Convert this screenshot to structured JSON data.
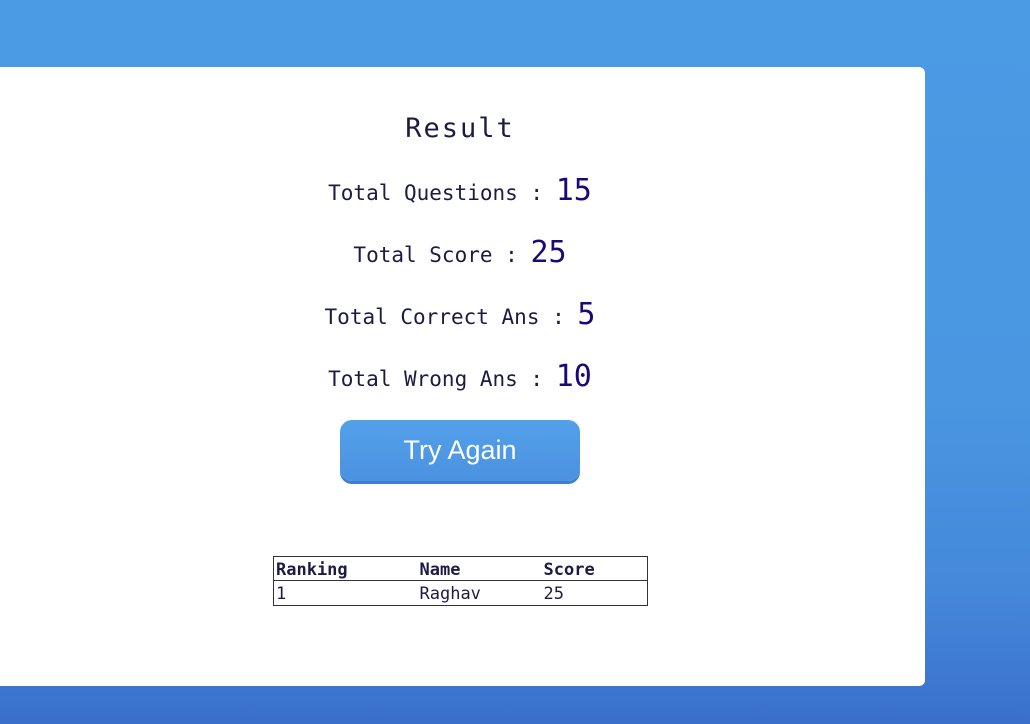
{
  "result": {
    "title": "Result",
    "stats": [
      {
        "label": "Total Questions : ",
        "value": "15"
      },
      {
        "label": "Total Score : ",
        "value": "25"
      },
      {
        "label": "Total Correct Ans : ",
        "value": "5"
      },
      {
        "label": "Total Wrong Ans : ",
        "value": "10"
      }
    ],
    "try_again_label": "Try Again"
  },
  "leaderboard": {
    "headers": [
      "Ranking",
      "Name",
      "Score"
    ],
    "rows": [
      [
        "1",
        "Raghav",
        "25"
      ]
    ]
  },
  "colors": {
    "background": "#4b9ae4",
    "card": "#ffffff",
    "text": "#1d1b44",
    "value": "#1a0a78",
    "button": "#4b92e0"
  }
}
